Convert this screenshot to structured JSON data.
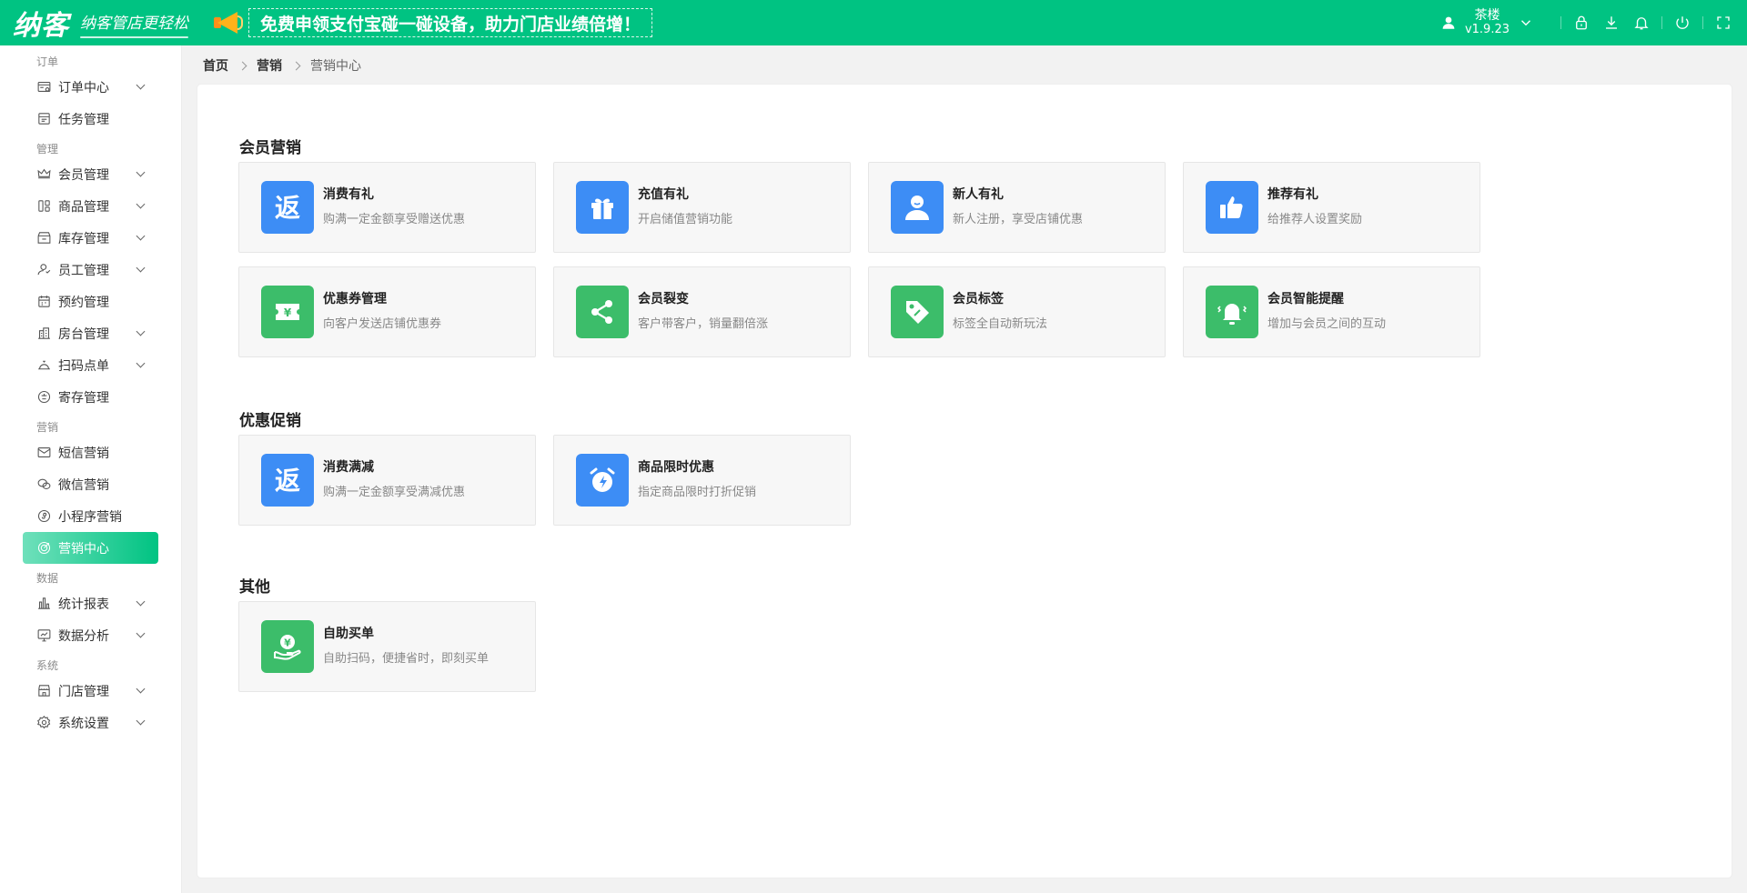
{
  "header": {
    "logo": "纳客",
    "slogan": "纳客管店更轻松",
    "promo": "免费申领支付宝碰一碰设备，助力门店业绩倍增！",
    "user_name": "茶楼",
    "version": "v1.9.23",
    "icons": [
      "user-icon",
      "lock-icon",
      "download-icon",
      "bell-icon",
      "power-icon",
      "fullscreen-icon"
    ]
  },
  "sidebar": {
    "sections": [
      {
        "title": "订单",
        "items": [
          {
            "label": "订单中心",
            "icon": "order-icon",
            "has_children": true
          },
          {
            "label": "任务管理",
            "icon": "task-icon",
            "has_children": false
          }
        ]
      },
      {
        "title": "管理",
        "items": [
          {
            "label": "会员管理",
            "icon": "crown-icon",
            "has_children": true
          },
          {
            "label": "商品管理",
            "icon": "goods-icon",
            "has_children": true
          },
          {
            "label": "库存管理",
            "icon": "store-icon",
            "has_children": true
          },
          {
            "label": "员工管理",
            "icon": "staff-icon",
            "has_children": true
          },
          {
            "label": "预约管理",
            "icon": "calendar-icon",
            "has_children": false
          },
          {
            "label": "房台管理",
            "icon": "building-icon",
            "has_children": true
          },
          {
            "label": "扫码点单",
            "icon": "bell-tray-icon",
            "has_children": true
          },
          {
            "label": "寄存管理",
            "icon": "deposit-icon",
            "has_children": false
          }
        ]
      },
      {
        "title": "营销",
        "items": [
          {
            "label": "短信营销",
            "icon": "mail-icon",
            "has_children": false
          },
          {
            "label": "微信营销",
            "icon": "wechat-icon",
            "has_children": false
          },
          {
            "label": "小程序营销",
            "icon": "miniapp-icon",
            "has_children": false
          },
          {
            "label": "营销中心",
            "icon": "target-icon",
            "has_children": false,
            "active": true
          }
        ]
      },
      {
        "title": "数据",
        "items": [
          {
            "label": "统计报表",
            "icon": "bar-chart-icon",
            "has_children": true
          },
          {
            "label": "数据分析",
            "icon": "monitor-icon",
            "has_children": true
          }
        ]
      },
      {
        "title": "系统",
        "items": [
          {
            "label": "门店管理",
            "icon": "shop-icon",
            "has_children": true
          },
          {
            "label": "系统设置",
            "icon": "gear-icon",
            "has_children": true
          }
        ]
      }
    ]
  },
  "breadcrumb": [
    "首页",
    "营销",
    "营销中心"
  ],
  "groups": [
    {
      "title": "会员营销",
      "cards": [
        {
          "title": "消费有礼",
          "desc": "购满一定金额享受赠送优惠",
          "icon": "return-icon",
          "color": "blue"
        },
        {
          "title": "充值有礼",
          "desc": "开启储值营销功能",
          "icon": "gift-icon",
          "color": "blue"
        },
        {
          "title": "新人有礼",
          "desc": "新人注册，享受店铺优惠",
          "icon": "person-icon",
          "color": "blue"
        },
        {
          "title": "推荐有礼",
          "desc": "给推荐人设置奖励",
          "icon": "thumbs-up-icon",
          "color": "blue"
        },
        {
          "title": "优惠券管理",
          "desc": "向客户发送店铺优惠券",
          "icon": "coupon-icon",
          "color": "green"
        },
        {
          "title": "会员裂变",
          "desc": "客户带客户，销量翻倍涨",
          "icon": "share-icon",
          "color": "green"
        },
        {
          "title": "会员标签",
          "desc": "标签全自动新玩法",
          "icon": "tag-icon",
          "color": "green"
        },
        {
          "title": "会员智能提醒",
          "desc": "增加与会员之间的互动",
          "icon": "alert-bell-icon",
          "color": "green"
        }
      ]
    },
    {
      "title": "优惠促销",
      "cards": [
        {
          "title": "消费满减",
          "desc": "购满一定金额享受满减优惠",
          "icon": "return-icon",
          "color": "blue"
        },
        {
          "title": "商品限时优惠",
          "desc": "指定商品限时打折促销",
          "icon": "alarm-clock-icon",
          "color": "blue"
        }
      ]
    },
    {
      "title": "其他",
      "cards": [
        {
          "title": "自助买单",
          "desc": "自助扫码，便捷省时，即刻买单",
          "icon": "hand-coin-icon",
          "color": "green"
        }
      ]
    }
  ],
  "colors": {
    "brand": "#00c382",
    "blue": "#3d8df5",
    "green": "#3cbd6a"
  }
}
